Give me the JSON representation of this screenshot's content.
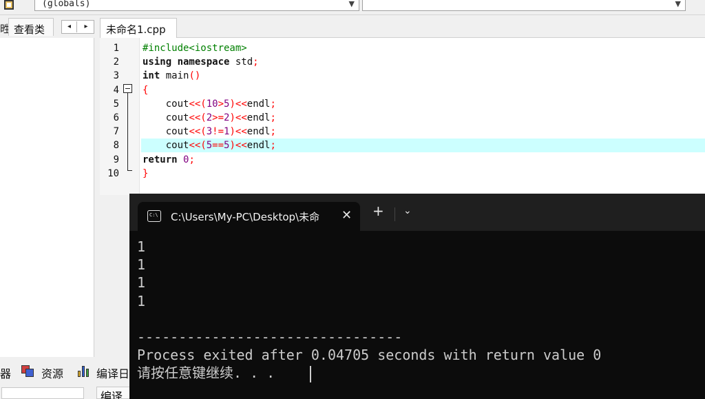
{
  "toolbar": {
    "scope_value": "(globals)",
    "member_value": ""
  },
  "left_panel": {
    "edge_label": "甠",
    "tab_label": "查看类",
    "nav_prev": "◂",
    "nav_next": "▸"
  },
  "bottom_tabs": {
    "edge_label": "器",
    "resources_label": "资源",
    "compile_label": "编译日",
    "strip_label": "编译"
  },
  "editor": {
    "file_tab": "未命名1.cpp",
    "highlighted_line": 8,
    "lines": [
      {
        "n": "1",
        "tokens": [
          [
            "pp",
            "#include<iostream>"
          ]
        ]
      },
      {
        "n": "2",
        "tokens": [
          [
            "kw",
            "using namespace"
          ],
          [
            "txt",
            " std"
          ],
          [
            "sym",
            ";"
          ]
        ]
      },
      {
        "n": "3",
        "tokens": [
          [
            "kw",
            "int"
          ],
          [
            "txt",
            " main"
          ],
          [
            "sym",
            "()"
          ]
        ]
      },
      {
        "n": "4",
        "tokens": [
          [
            "sym",
            "{"
          ]
        ]
      },
      {
        "n": "5",
        "tokens": [
          [
            "txt",
            "    cout"
          ],
          [
            "sym",
            "<<("
          ],
          [
            "num",
            "10"
          ],
          [
            "sym",
            ">"
          ],
          [
            "num",
            "5"
          ],
          [
            "sym",
            ")<<"
          ],
          [
            "txt",
            "endl"
          ],
          [
            "sym",
            ";"
          ]
        ]
      },
      {
        "n": "6",
        "tokens": [
          [
            "txt",
            "    cout"
          ],
          [
            "sym",
            "<<("
          ],
          [
            "num",
            "2"
          ],
          [
            "sym",
            ">="
          ],
          [
            "num",
            "2"
          ],
          [
            "sym",
            ")<<"
          ],
          [
            "txt",
            "endl"
          ],
          [
            "sym",
            ";"
          ]
        ]
      },
      {
        "n": "7",
        "tokens": [
          [
            "txt",
            "    cout"
          ],
          [
            "sym",
            "<<("
          ],
          [
            "num",
            "3"
          ],
          [
            "sym",
            "!="
          ],
          [
            "num",
            "1"
          ],
          [
            "sym",
            ")<<"
          ],
          [
            "txt",
            "endl"
          ],
          [
            "sym",
            ";"
          ]
        ]
      },
      {
        "n": "8",
        "tokens": [
          [
            "txt",
            "    cout"
          ],
          [
            "sym",
            "<<("
          ],
          [
            "num",
            "5"
          ],
          [
            "sym",
            "=="
          ],
          [
            "num",
            "5"
          ],
          [
            "sym",
            ")<<"
          ],
          [
            "txt",
            "endl"
          ],
          [
            "sym",
            ";"
          ]
        ]
      },
      {
        "n": "9",
        "tokens": [
          [
            "kw",
            "return"
          ],
          [
            "txt",
            " "
          ],
          [
            "num",
            "0"
          ],
          [
            "sym",
            ";"
          ]
        ]
      },
      {
        "n": "10",
        "tokens": [
          [
            "sym",
            "}"
          ]
        ]
      }
    ]
  },
  "terminal": {
    "tab_title": "C:\\Users\\My-PC\\Desktop\\未命",
    "close_glyph": "✕",
    "new_tab_glyph": "+",
    "dropdown_glyph": "⌄",
    "output_lines": [
      "1",
      "1",
      "1",
      "1",
      "",
      "--------------------------------",
      "Process exited after 0.04705 seconds with return value 0",
      "请按任意键继续. . ."
    ]
  }
}
